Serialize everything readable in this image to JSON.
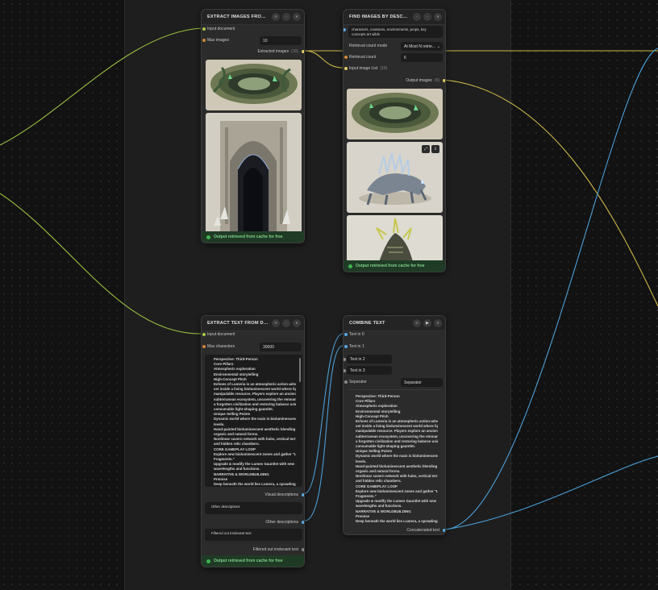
{
  "colors": {
    "canvas": "#121212",
    "group": "#1e1e1e",
    "node": "#2b2b2b",
    "wire_yellow": "#cdb84a",
    "wire_blue": "#4b9ed6",
    "wire_green": "#9bbf3f",
    "footer_bg": "#1f3b25",
    "footer_text": "#7fd28a"
  },
  "nodes": {
    "extract_images": {
      "title": "EXTRACT IMAGES FROM ...",
      "input_document": "Input document",
      "max_images_label": "Max images",
      "max_images_value": "10",
      "extracted_images_label": "Extracted images",
      "extracted_images_count": "(10)",
      "images": [
        "cave-tunnel-image",
        "gothic-archway-image"
      ],
      "footer": "Output retrieved from cache for free"
    },
    "find_images": {
      "title": "FIND IMAGES BY DESCRIP...",
      "query_text": "characters, creatures, environments, props, key concepts art wilds",
      "retrieval_mode_label": "Retrieval count mode",
      "retrieval_mode_value": "At Most N retrie...",
      "retrieval_count_label": "Retrieval count",
      "retrieval_count_value": "6",
      "input_image_list_label": "Input image List",
      "input_image_list_count": "(10)",
      "output_images_label": "Output images",
      "output_images_count": "(6)",
      "images": [
        "cave-tunnel-image",
        "crystal-creature-image",
        "armored-dragon-image"
      ],
      "footer": "Output retrieved from cache for free"
    },
    "extract_text": {
      "title": "EXTRACT TEXT FROM DO...",
      "input_document": "Input document",
      "max_characters_label": "Max characters",
      "max_characters_value": "30000",
      "text_lines": [
        "Perspective: Third-Person",
        "Core Pillars",
        "Atmospheric exploration",
        "Environmental storytelling",
        "High-Concept Pitch",
        "Echoes of Lumeria is an atmospheric action-adventure",
        "set inside a living bioluminescent world where light is a",
        "manipulable resource. Players explore an ancient",
        "subterranean ecosystem, uncovering the remnants of",
        "a forgotten civilization and restoring balance using a",
        "consumable light-shaping gauntlet.",
        "Unique Selling Points",
        "Dynamic world where the main is bioluminescence",
        "levels.",
        "Hand-painted bioluminescent aesthetic blending",
        "organic and natural forms.",
        "Nonlinear cavern network with hubs, vertical terrain,",
        "and hidden relic chambers.",
        "CORE GAMEPLAY LOOP",
        "Explore new bioluminescent zones and gather \"Lumen",
        "Fragments.\"",
        "Upgrade & modify the Lumen Gauntlet with new",
        "wavelengths and functions.",
        "NARRATIVE & WORLDBUILDING",
        "Premise",
        "Deep beneath the world lies Lumera, a sprawling"
      ],
      "visual_descriptions_label": "Visual descriptions",
      "other_descriptions_placeholder": "Other descriptions",
      "other_descriptions_label": "Other descriptions",
      "filtered_placeholder": "Filtered out irrelevant text",
      "filtered_label": "Filtered out irrelevant text",
      "footer": "Output retrieved from cache for free"
    },
    "combine_text": {
      "title": "COMBINE TEXT",
      "text_in_0": "Text in 0",
      "text_in_1": "Text in 1",
      "text_in_2": "Text in 2",
      "text_in_3": "Text in 3",
      "separator_label": "Separator",
      "separator_value": "Separator",
      "text_lines": [
        "Perspective: Third-Person",
        "Core Pillars",
        "Atmospheric exploration",
        "Environmental storytelling",
        "High-Concept Pitch",
        "Echoes of Lumeria is an atmospheric action-adventure",
        "set inside a living bioluminescent world where light is a",
        "manipulable resource. Players explore an ancient",
        "subterranean ecosystem, uncovering the remnants of",
        "a forgotten civilization and restoring balance using a",
        "consumable light-shaping gauntlet.",
        "Unique Selling Points",
        "Dynamic world where the main is bioluminescence",
        "levels.",
        "Hand-painted bioluminescent aesthetic blending",
        "organic and natural forms.",
        "Nonlinear cavern network with hubs, vertical terrain,",
        "and hidden relic chambers.",
        "CORE GAMEPLAY LOOP",
        "Explore new bioluminescent zones and gather \"Lumen",
        "Fragments.\"",
        "Upgrade & modify the Lumen Gauntlet with new",
        "wavelengths and functions.",
        "NARRATIVE & WORLDBUILDING",
        "Premise",
        "Deep beneath the world lies Lumera, a sprawling"
      ],
      "concatenated_label": "Concatenated text"
    }
  }
}
